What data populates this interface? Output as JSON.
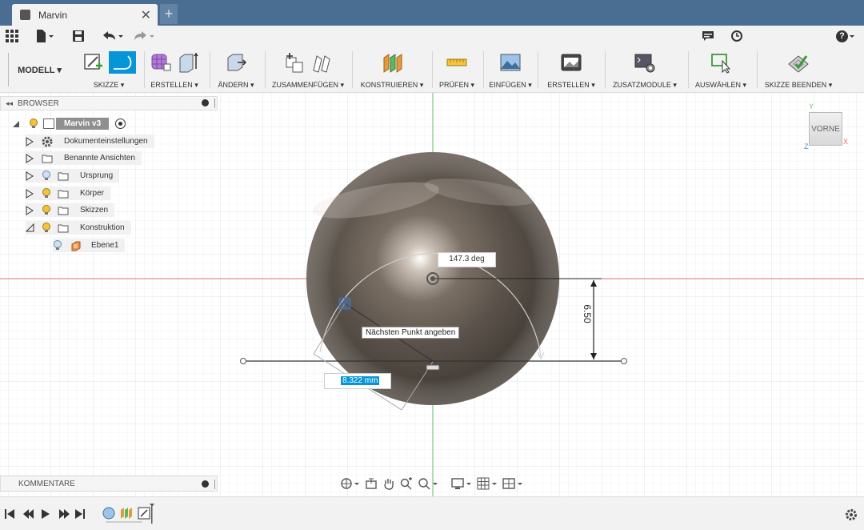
{
  "window": {
    "tab_title": "Marvin",
    "close_glyph": "✕",
    "new_tab_glyph": "+"
  },
  "qbar": {
    "help_glyph": "?"
  },
  "ribbon": {
    "workspace": "MODELL ▾",
    "groups": [
      {
        "label": "SKIZZE ▾"
      },
      {
        "label": "ERSTELLEN ▾"
      },
      {
        "label": "ÄNDERN ▾"
      },
      {
        "label": "ZUSAMMENFÜGEN ▾"
      },
      {
        "label": "KONSTRUIEREN ▾"
      },
      {
        "label": "PRÜFEN ▾"
      },
      {
        "label": "EINFÜGEN ▾"
      },
      {
        "label": "ERSTELLEN ▾"
      },
      {
        "label": "ZUSATZMODULE ▾"
      },
      {
        "label": "AUSWÄHLEN ▾"
      },
      {
        "label": "SKIZZE BEENDEN ▾"
      }
    ]
  },
  "browser": {
    "title": "BROWSER",
    "root": "Marvin v3",
    "items": [
      {
        "label": "Dokumenteinstellungen"
      },
      {
        "label": "Benannte Ansichten"
      },
      {
        "label": "Ursprung"
      },
      {
        "label": "Körper"
      },
      {
        "label": "Skizzen"
      },
      {
        "label": "Konstruktion"
      },
      {
        "label": "Ebene1"
      }
    ]
  },
  "viewcube": {
    "face": "VORNE",
    "axis_y": "Y",
    "axis_x": "X",
    "axis_z": "Z"
  },
  "sketch": {
    "angle": "147.3 deg",
    "dimension": "6.50",
    "tooltip": "Nächsten Punkt angeben",
    "length_input": "8.322 mm"
  },
  "comments": {
    "title": "KOMMENTARE"
  },
  "colors": {
    "tab_bar": "#4a6d92",
    "accent": "#0696d7",
    "x_axis": "#d9534f",
    "y_axis": "#5cb85c"
  }
}
